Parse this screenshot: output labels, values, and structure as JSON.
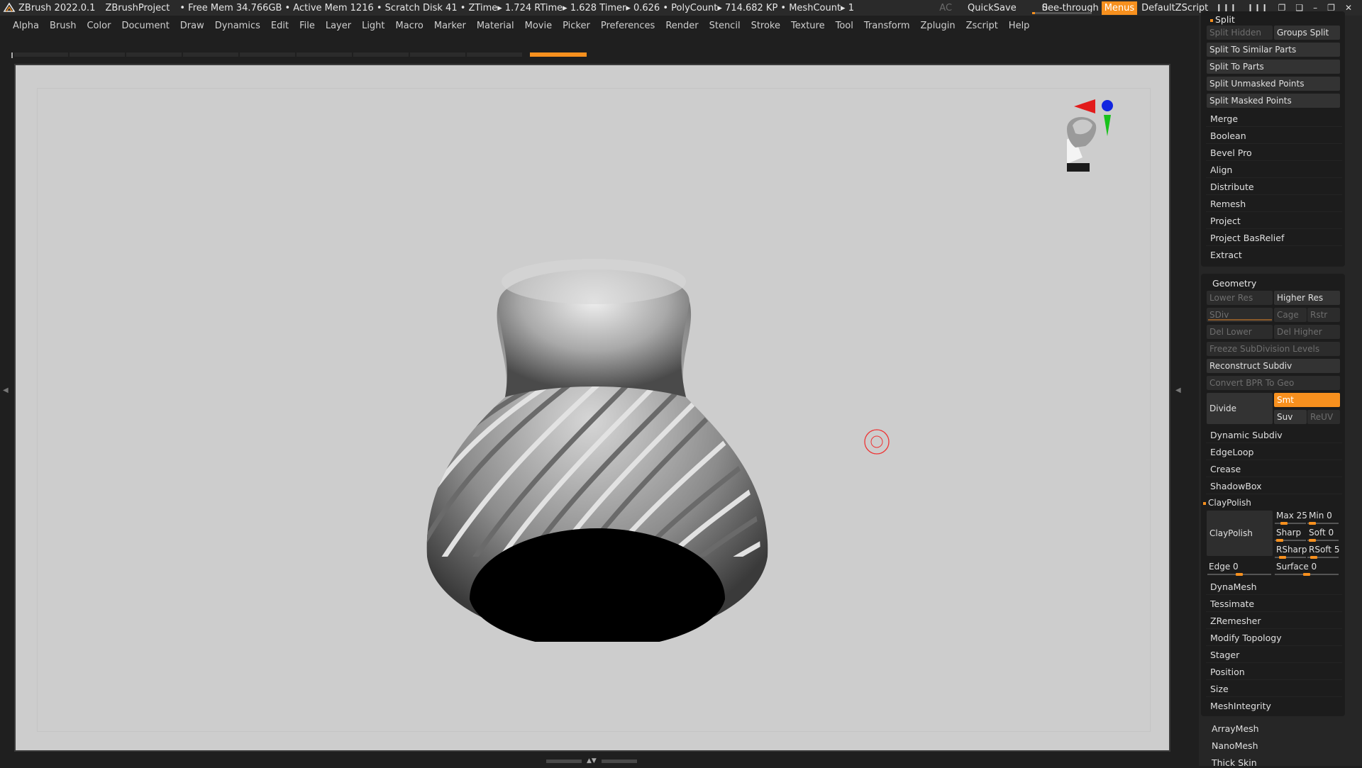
{
  "titlebar": {
    "app": "ZBrush 2022.0.1",
    "project": "ZBrushProject",
    "stats": "• Free Mem 34.766GB • Active Mem 1216 • Scratch Disk 41  • ZTime▸ 1.724 RTime▸ 1.628 Timer▸ 0.626 • PolyCount▸ 714.682 KP  • MeshCount▸ 1",
    "ac": "AC",
    "quicksave": "QuickSave",
    "see_through_label": "See-through",
    "see_through_value": "0",
    "see_through_level": 0.0,
    "menus": "Menus",
    "script": "DefaultZScript"
  },
  "menubar": [
    "Alpha",
    "Brush",
    "Color",
    "Document",
    "Draw",
    "Dynamics",
    "Edit",
    "File",
    "Layer",
    "Light",
    "Macro",
    "Marker",
    "Material",
    "Movie",
    "Picker",
    "Preferences",
    "Render",
    "Stencil",
    "Stroke",
    "Texture",
    "Tool",
    "Transform",
    "Zplugin",
    "Zscript",
    "Help"
  ],
  "icons": {
    "app_logo": "zbrush-logo-icon",
    "accent": "#f7901e",
    "axis_red": "#e21b1b",
    "axis_green": "#18c21b",
    "axis_blue": "#1226e0"
  },
  "panel": {
    "split_header": "Split",
    "split_hidden": "Split Hidden",
    "groups_split": "Groups Split",
    "split_buttons": [
      "Split To Similar Parts",
      "Split To Parts",
      "Split Unmasked Points",
      "Split Masked Points"
    ],
    "subtool_items": [
      "Merge",
      "Boolean",
      "Bevel Pro",
      "Align",
      "Distribute",
      "Remesh",
      "Project",
      "Project BasRelief",
      "Extract"
    ],
    "geometry": {
      "title": "Geometry",
      "lower_res": "Lower Res",
      "higher_res": "Higher Res",
      "sdiv": "SDiv",
      "cage": "Cage",
      "rstr": "Rstr",
      "del_lower": "Del Lower",
      "del_higher": "Del Higher",
      "freeze": "Freeze SubDivision Levels",
      "reconstruct": "Reconstruct Subdiv",
      "convert_bpr": "Convert BPR To Geo",
      "divide": "Divide",
      "smt": "Smt",
      "suv": "Suv",
      "reuv": "ReUV",
      "items_a": [
        "Dynamic Subdiv",
        "EdgeLoop",
        "Crease",
        "ShadowBox"
      ],
      "claypolish_header": "ClayPolish",
      "claypolish_button": "ClayPolish",
      "max_label": "Max",
      "max_value": "25",
      "min_label": "Min",
      "min_value": "0",
      "sharp_label": "Sharp",
      "soft_label": "Soft",
      "soft_value": "0",
      "rsharp_label": "RSharp",
      "rsoft_label": "RSoft",
      "rsoft_value": "5",
      "edge_label": "Edge",
      "edge_value": "0",
      "surface_label": "Surface",
      "surface_value": "0",
      "items_b": [
        "DynaMesh",
        "Tessimate",
        "ZRemesher",
        "Modify Topology",
        "Stager",
        "Position",
        "Size",
        "MeshIntegrity"
      ]
    },
    "extra_items": [
      "ArrayMesh",
      "NanoMesh",
      "Thick Skin"
    ]
  }
}
